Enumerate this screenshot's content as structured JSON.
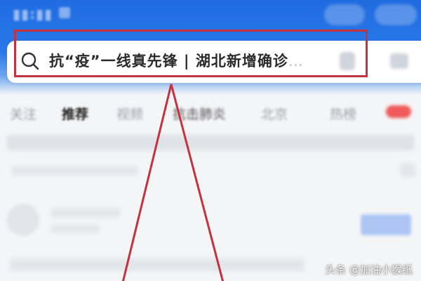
{
  "search": {
    "query_text": "抗“疫”一线真先锋 | 湖北新增确诊",
    "ellipsis": "…",
    "icon": "search-icon"
  },
  "tabs": [
    {
      "label": "关注",
      "active": false
    },
    {
      "label": "推荐",
      "active": true
    },
    {
      "label": "视频",
      "active": false
    },
    {
      "label": "抗击肺炎",
      "active": false
    },
    {
      "label": "北京",
      "active": false
    },
    {
      "label": "热榜",
      "active": false
    }
  ],
  "annotation": {
    "color": "#c3323f"
  },
  "watermark": {
    "text": "头条 @加油小猴纸"
  },
  "colors": {
    "brand_blue": "#1f6be0",
    "highlight_red": "#c3323f"
  }
}
